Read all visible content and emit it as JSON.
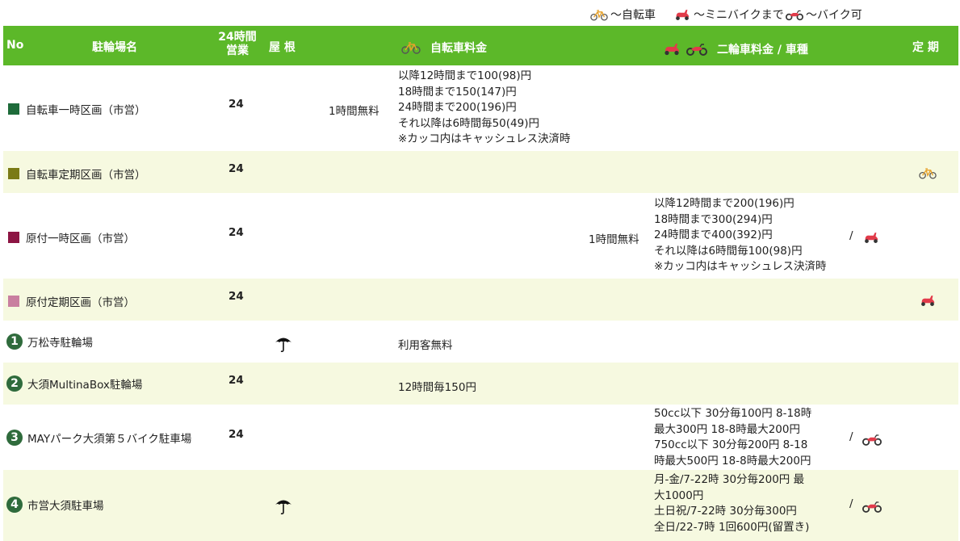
{
  "legend": {
    "bicycle": "～自転車",
    "minibike": "～ミニバイクまで",
    "bike": "～バイク可"
  },
  "header": {
    "no": "No",
    "name": "駐輪場名",
    "hours_line1": "24時間",
    "hours_line2": "営業",
    "roof": "屋 根",
    "bicycle_fee": "自転車料金",
    "moto_fee": "二輪車料金 / 車種",
    "pass": "定 期"
  },
  "colors": {
    "header_bg": "#5cb829",
    "alt_row_bg": "#f6f9e0",
    "number_badge": "#2f6b3c",
    "scooter_red": "#e23b4a"
  },
  "rows": [
    {
      "marker_color": "#1e6b3a",
      "name": "自転車一時区画（市営）",
      "hours": "24",
      "bicycle_free": "1時間無料",
      "bicycle_fee_lines": [
        "以降12時間まで100(98)円",
        "18時間まで150(147)円",
        "24時間まで200(196)円",
        "それ以降は6時間毎50(49)円",
        "※カッコ内はキャッシュレス決済時"
      ]
    },
    {
      "marker_color": "#7a7a16",
      "name": "自転車定期区画（市営）",
      "hours": "24",
      "pass_icon": "bicycle-icon"
    },
    {
      "marker_color": "#8c1543",
      "name": "原付一時区画（市営）",
      "hours": "24",
      "moto_free": "1時間無料",
      "moto_fee_lines": [
        "以降12時間まで200(196)円",
        "18時間まで300(294)円",
        "24時間まで400(392)円",
        "それ以降は6時間毎100(98)円",
        "※カッコ内はキャッシュレス決済時"
      ],
      "slash": "/",
      "type_icon": "scooter-icon"
    },
    {
      "marker_color": "#c97fa0",
      "name": "原付定期区画（市営）",
      "hours": "24",
      "pass_icon": "scooter-icon"
    },
    {
      "number": "1",
      "name": "万松寺駐輪場",
      "roof_icon": "umbrella-icon",
      "bicycle_fee": "利用客無料"
    },
    {
      "number": "2",
      "name": "大須MultinaBox駐輪場",
      "hours": "24",
      "bicycle_fee": "12時間毎150円"
    },
    {
      "number": "3",
      "name": "MAYパーク大須第５バイク駐車場",
      "hours": "24",
      "moto_fee_lines": [
        "50cc以下 30分毎100円 8-18時",
        "最大300円 18-8時最大200円",
        "750cc以下 30分毎200円 8-18",
        "時最大500円 18-8時最大200円"
      ],
      "slash": "/",
      "type_icon": "motorcycle-icon"
    },
    {
      "number": "4",
      "name": "市営大須駐車場",
      "roof_icon": "umbrella-icon",
      "moto_fee_lines": [
        "月-金/7-22時 30分毎200円 最",
        "大1000円",
        "土日祝/7-22時 30分毎300円",
        "全日/22-7時 1回600円(留置き)"
      ],
      "slash": "/",
      "type_icon": "motorcycle-icon"
    }
  ]
}
